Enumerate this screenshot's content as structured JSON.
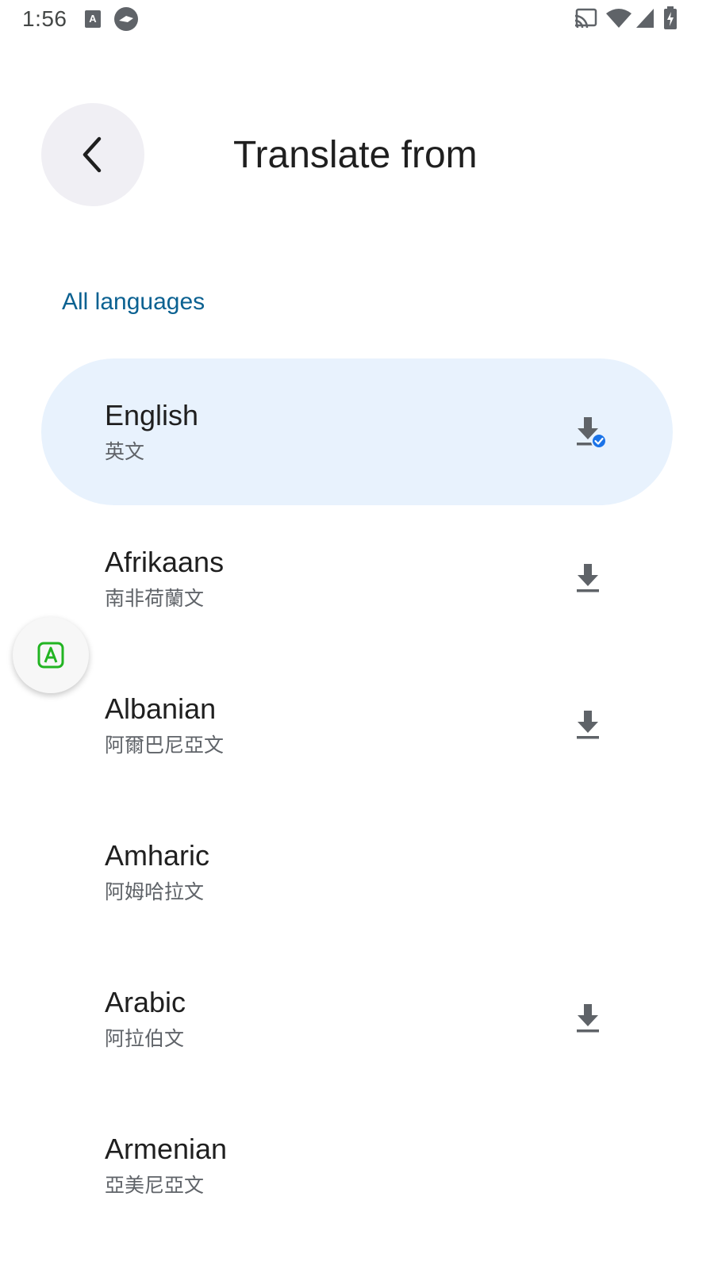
{
  "status_bar": {
    "time": "1:56",
    "icons": [
      "translate-notification-icon",
      "privacy-notification-icon",
      "cast-icon",
      "wifi-icon",
      "cellular-signal-icon",
      "battery-charging-icon"
    ]
  },
  "header": {
    "back_icon": "chevron-left-icon",
    "title": "Translate from"
  },
  "section": {
    "heading": "All languages"
  },
  "languages": [
    {
      "name": "English",
      "native": "英文",
      "download": "downloaded",
      "selected": true
    },
    {
      "name": "Afrikaans",
      "native": "南非荷蘭文",
      "download": "available",
      "selected": false
    },
    {
      "name": "Albanian",
      "native": "阿爾巴尼亞文",
      "download": "available",
      "selected": false
    },
    {
      "name": "Amharic",
      "native": "阿姆哈拉文",
      "download": "none",
      "selected": false
    },
    {
      "name": "Arabic",
      "native": "阿拉伯文",
      "download": "available",
      "selected": false
    },
    {
      "name": "Armenian",
      "native": "亞美尼亞文",
      "download": "none",
      "selected": false
    }
  ],
  "floating_button": {
    "icon": "letter-a-translate-icon"
  },
  "colors": {
    "selected_background": "#e8f2fd",
    "section_heading": "#0b6191",
    "download_icon": "#5f6368",
    "downloaded_badge": "#1a73e8",
    "float_icon": "#22b422"
  }
}
